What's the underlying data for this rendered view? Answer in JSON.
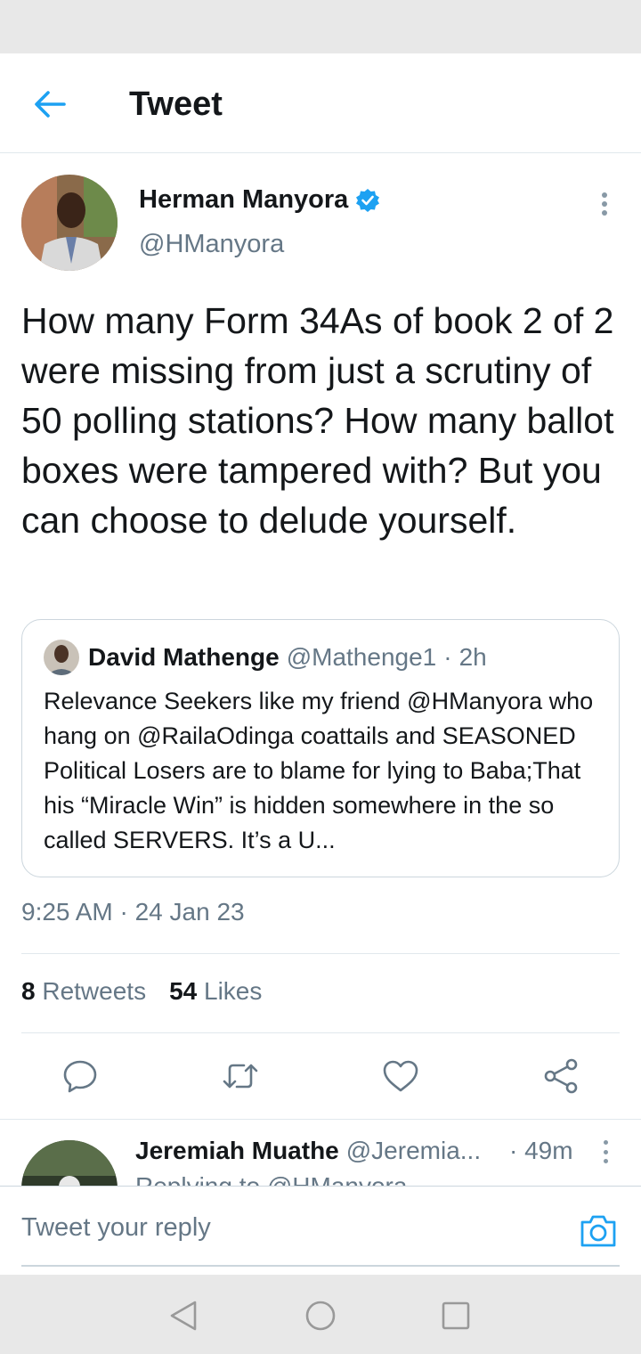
{
  "header": {
    "title": "Tweet",
    "back_icon": "arrow-left-icon"
  },
  "tweet": {
    "author_name": "Herman Manyora",
    "author_handle": "@HManyora",
    "verified": true,
    "text": "How many Form 34As of book 2 of 2 were missing from just a scrutiny of 50 polling stations? How many ballot boxes were tampered with? But you can choose to delude yourself.",
    "timestamp": "9:25 AM · 24 Jan 23",
    "retweets_count": "8",
    "retweets_label": "Retweets",
    "likes_count": "54",
    "likes_label": "Likes"
  },
  "quoted_tweet": {
    "author_name": "David Mathenge",
    "author_handle": "@Mathenge1",
    "separator": "·",
    "time": "2h",
    "text": "Relevance Seekers like my friend @HManyora who hang on @RailaOdinga coattails and SEASONED Political Losers are to blame for lying to Baba;That his “Miracle Win” is hidden somewhere in the so called SERVERS. It’s a U..."
  },
  "actions": [
    "reply-icon",
    "retweet-icon",
    "like-icon",
    "share-icon"
  ],
  "reply": {
    "author_name": "Jeremiah Muathe",
    "author_handle": "@Jeremia...",
    "time": "· 49m",
    "replying_to": "Replying to @HManyora"
  },
  "compose": {
    "placeholder": "Tweet your reply"
  },
  "colors": {
    "accent": "#1da1f2",
    "secondary_text": "#657786",
    "border": "#e1e8ed"
  }
}
